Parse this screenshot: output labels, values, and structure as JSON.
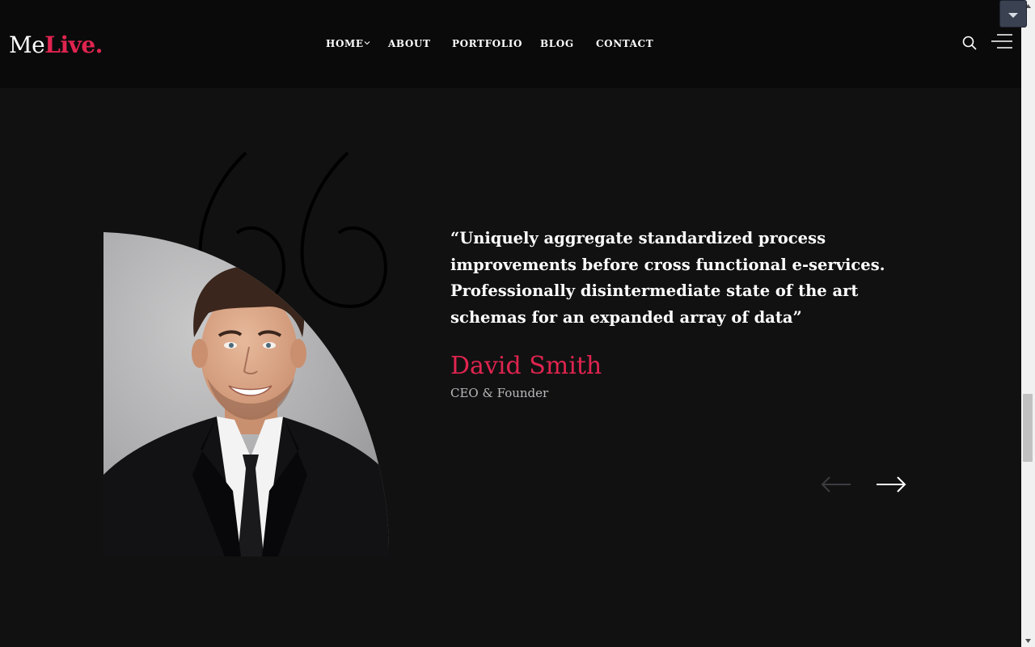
{
  "brand": {
    "name_part1": "Me",
    "name_part2": "Live."
  },
  "nav": {
    "items": [
      {
        "label": "HOME",
        "has_dropdown": true
      },
      {
        "label": "ABOUT"
      },
      {
        "label": "PORTFOLIO"
      },
      {
        "label": "BLOG"
      },
      {
        "label": "CONTACT"
      }
    ]
  },
  "header_icons": [
    "search-icon",
    "menu-icon"
  ],
  "testimonial": {
    "quote": "“Uniquely aggregate standardized process improvements before cross functional e-services. Professionally disintermediate state of the art schemas for an expanded array of data”",
    "name": "David Smith",
    "role": "CEO & Founder"
  },
  "colors": {
    "accent": "#e0244f",
    "background": "#111112",
    "header_background": "#0a0a0b",
    "text": "#ffffff",
    "muted_text": "#b9b9bd"
  }
}
